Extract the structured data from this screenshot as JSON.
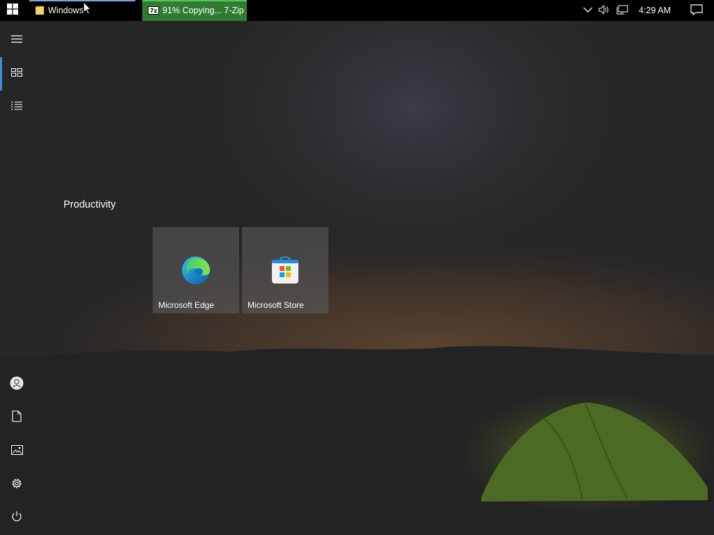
{
  "taskbar": {
    "windows": [
      {
        "label": "Windows",
        "icon": "folder-icon"
      },
      {
        "label": "91% Copying... 7-Zip",
        "icon": "7zip-icon"
      }
    ],
    "clock": "4:29 AM"
  },
  "start_menu": {
    "rail_top": [
      "menu-icon",
      "tiles-icon",
      "all-apps-icon"
    ],
    "rail_bottom": [
      "user-icon",
      "documents-icon",
      "pictures-icon",
      "settings-icon",
      "power-icon"
    ],
    "group_title": "Productivity",
    "tiles": [
      {
        "label": "Microsoft Edge",
        "icon": "edge-icon"
      },
      {
        "label": "Microsoft Store",
        "icon": "store-icon"
      }
    ]
  },
  "colors": {
    "accent": "#3b8fd9",
    "progress_green": "#2f7d32",
    "taskbar": "#000000"
  }
}
